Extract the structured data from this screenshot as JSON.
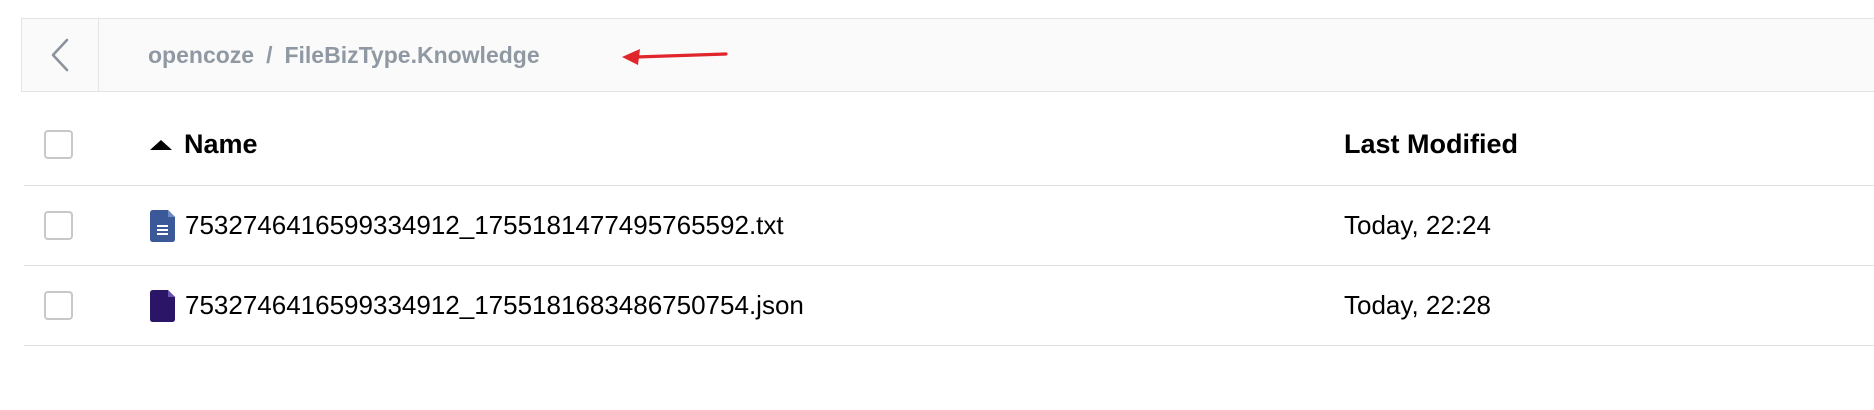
{
  "breadcrumb": {
    "root": "opencoze",
    "separator": "/",
    "current": "FileBizType.Knowledge"
  },
  "table": {
    "columns": {
      "name": "Name",
      "last_modified": "Last Modified"
    },
    "rows": [
      {
        "name": "7532746416599334912_1755181477495765592.txt",
        "modified": "Today, 22:24",
        "icon": "text-file-icon",
        "icon_color": "#3b5998"
      },
      {
        "name": "7532746416599334912_1755181683486750754.json",
        "modified": "Today, 22:28",
        "icon": "json-file-icon",
        "icon_color": "#2a1566"
      }
    ]
  },
  "colors": {
    "annotation_arrow": "#e0252b",
    "breadcrumb_text": "#9099a3"
  }
}
